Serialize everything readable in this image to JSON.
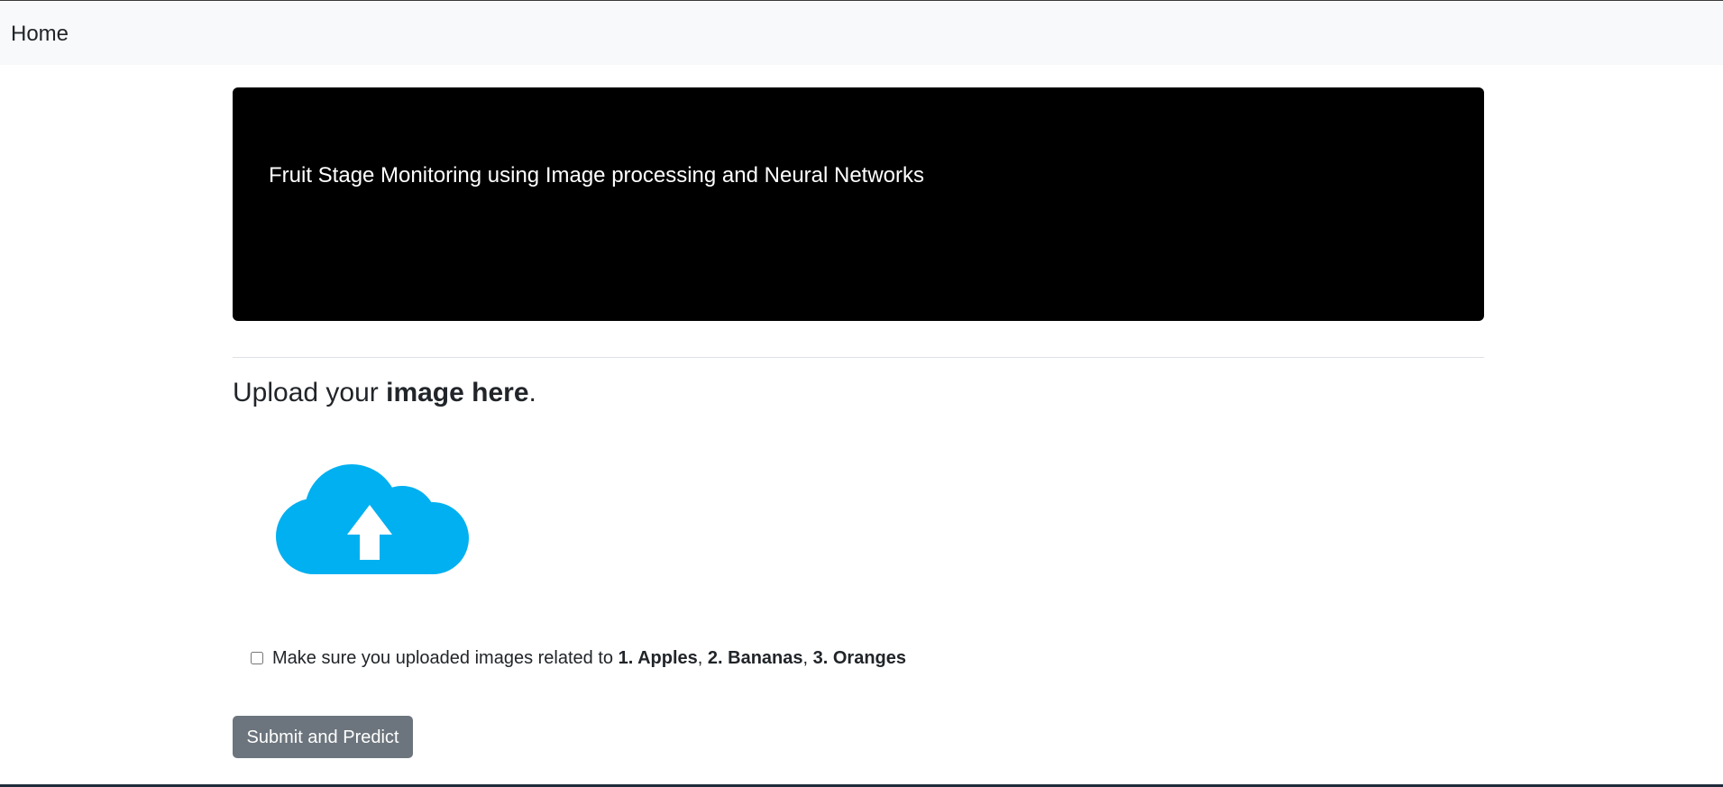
{
  "navbar": {
    "home_label": "Home"
  },
  "hero": {
    "title": "Fruit Stage Monitoring using Image processing and Neural Networks"
  },
  "upload": {
    "heading_prefix": "Upload your ",
    "heading_bold": "image here",
    "heading_suffix": ".",
    "icon": "cloud-upload-icon",
    "icon_color": "#00b0f0"
  },
  "confirm": {
    "checked": false,
    "text_prefix": "Make sure you uploaded images related to ",
    "item1": "1. Apples",
    "sep1": ", ",
    "item2": "2. Bananas",
    "sep2": ", ",
    "item3": "3. Oranges"
  },
  "submit": {
    "label": "Submit and Predict"
  },
  "colors": {
    "navbar_bg": "#f8f9fa",
    "hero_bg": "#000000",
    "button_bg": "#6c757d",
    "text": "#212529"
  }
}
